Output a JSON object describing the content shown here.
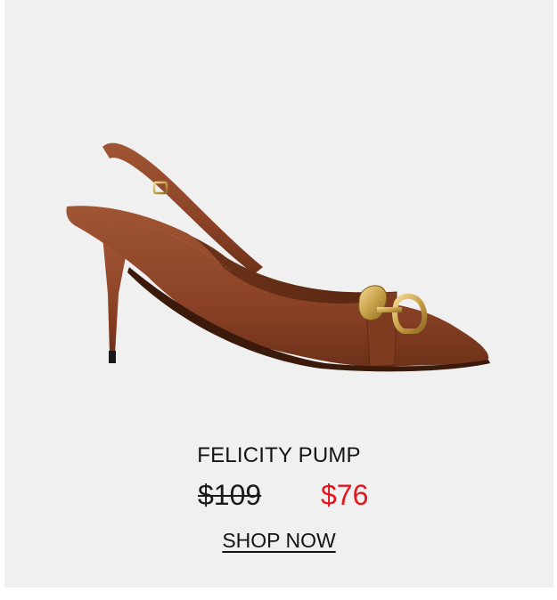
{
  "product": {
    "name": "FELICITY PUMP",
    "price_original": "$109",
    "price_sale": "$76",
    "cta_label": "SHOP NOW",
    "image_subject": "shoe-image"
  },
  "colors": {
    "card_background": "#f0f0f0",
    "sale_price": "#e5161d",
    "text": "#141414",
    "leather": "#8b4226",
    "buckle": "#c9a24a"
  }
}
